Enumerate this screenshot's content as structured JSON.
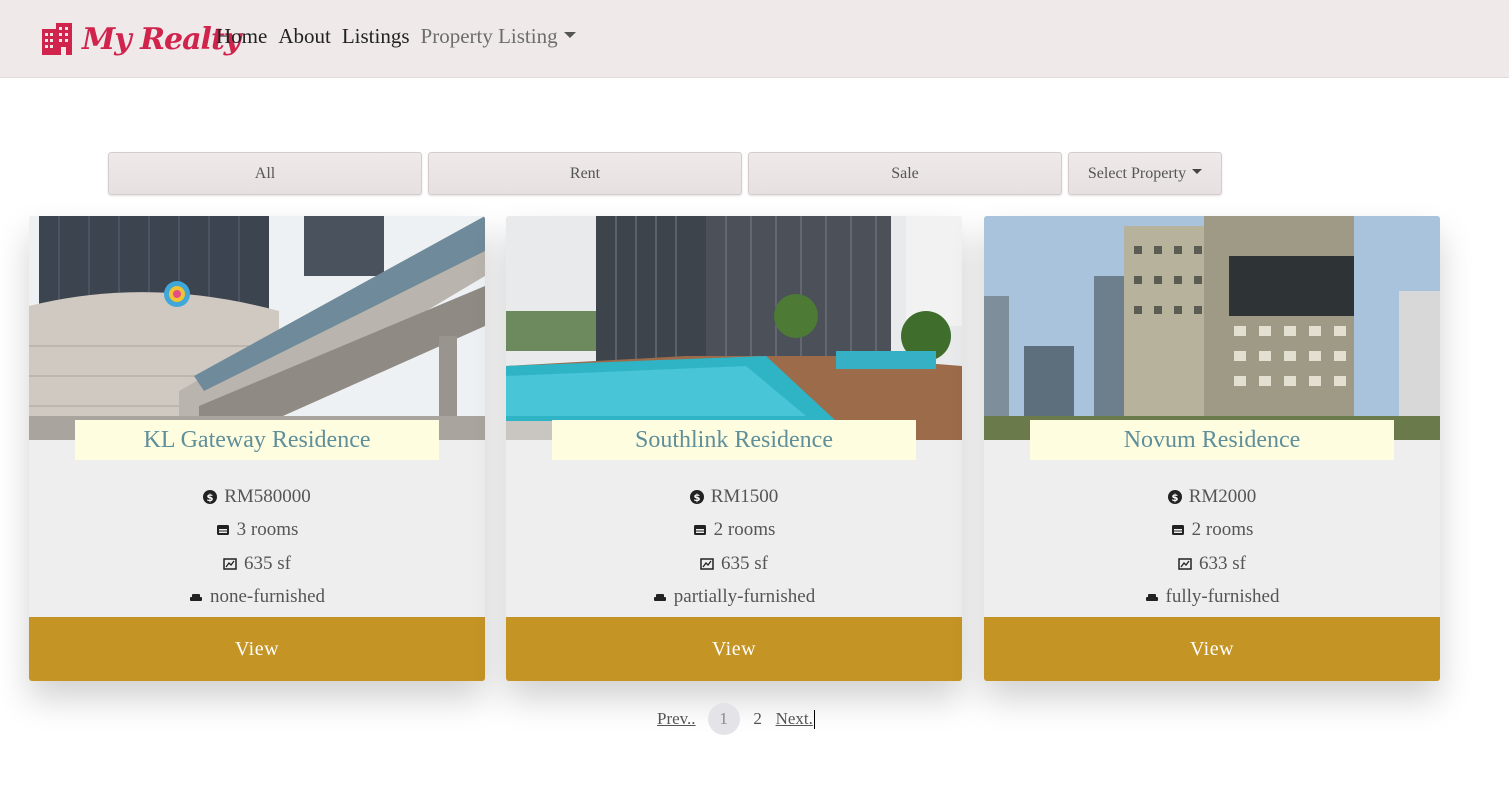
{
  "navbar": {
    "brand_text": "My Realty",
    "links": [
      {
        "label": "Home"
      },
      {
        "label": "About"
      },
      {
        "label": "Listings"
      }
    ],
    "dropdown_label": "Property Listing"
  },
  "filters": {
    "all_label": "All",
    "rent_label": "Rent",
    "sale_label": "Sale",
    "select_label": "Select Property"
  },
  "listings": [
    {
      "title": "KL Gateway Residence",
      "price": "RM580000",
      "rooms": "3 rooms",
      "size": "635 sf",
      "furnishing": "none-furnished",
      "button": "View"
    },
    {
      "title": "Southlink Residence",
      "price": "RM1500",
      "rooms": "2 rooms",
      "size": "635 sf",
      "furnishing": "partially-furnished",
      "button": "View"
    },
    {
      "title": "Novum Residence",
      "price": "RM2000",
      "rooms": "2 rooms",
      "size": "633 sf",
      "furnishing": "fully-furnished",
      "button": "View"
    }
  ],
  "pagination": {
    "prev_label": "Prev..",
    "pages": [
      "1",
      "2"
    ],
    "current_page": "1",
    "next_label": "Next."
  },
  "colors": {
    "brand": "#d0244d",
    "navbar_bg": "#efe9ea",
    "view_button": "#c49425",
    "title_bg": "#fffde0",
    "title_text": "#5f8f9a"
  }
}
